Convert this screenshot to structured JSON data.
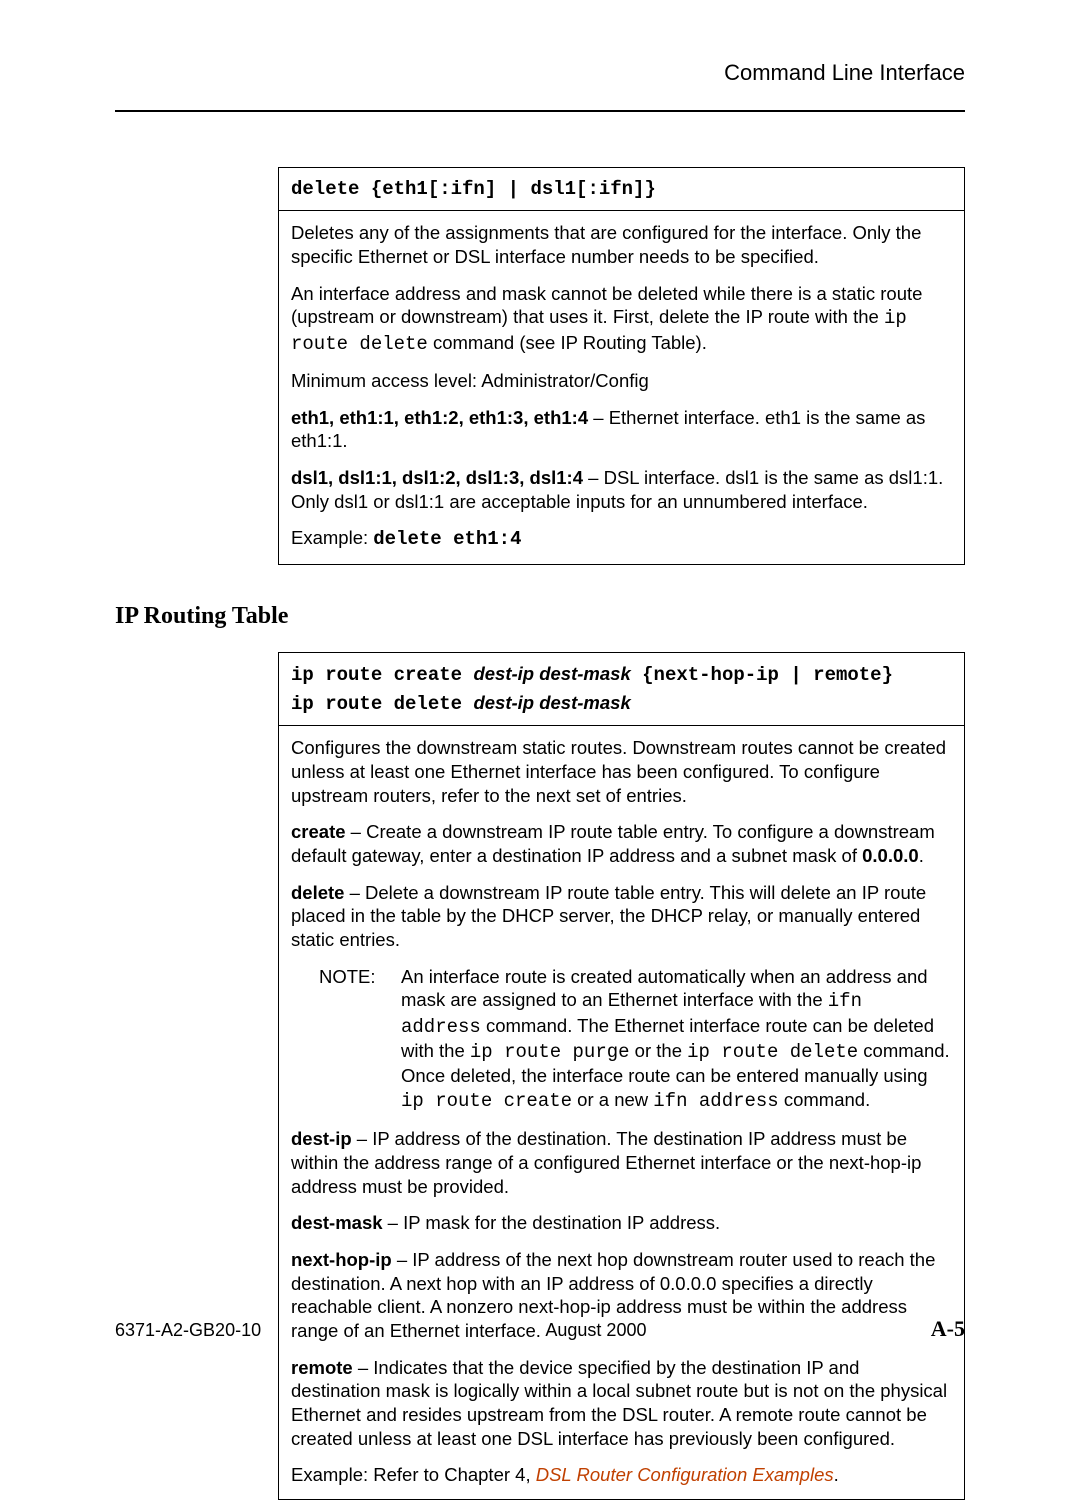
{
  "header": {
    "title": "Command Line Interface"
  },
  "box1": {
    "cmd": "delete {eth1[:ifn] | dsl1[:ifn]}",
    "p1": "Deletes any of the assignments that are configured for the interface. Only the specific Ethernet or DSL interface number needs to be specified.",
    "p2a": "An interface address and mask cannot be deleted while there is a static route (upstream or downstream) that uses it. First, delete the IP route with the ",
    "p2code": "ip route delete",
    "p2b": " command (see IP Routing Table).",
    "p3": "Minimum access level:  Administrator/Config",
    "p4b": "eth1, eth1:1, eth1:2, eth1:3, eth1:4",
    "p4t": " – Ethernet interface. eth1 is the same as eth1:1.",
    "p5b": "dsl1, dsl1:1, dsl1:2, dsl1:3, dsl1:4",
    "p5t1": " – DSL interface. dsl1 is the same as dsl1:1.",
    "p5t2": "Only dsl1 or dsl1:1 are acceptable inputs for an unnumbered interface.",
    "p6a": "Example:  ",
    "p6code": "delete eth1:4"
  },
  "section2": {
    "title": "IP Routing Table"
  },
  "box2": {
    "cmd1a": "ip route create ",
    "cmd1i": "dest-ip dest-mask",
    "cmd1b": " {next-hop-ip | remote}",
    "cmd2a": "ip route delete ",
    "cmd2i": "dest-ip dest-mask",
    "p1": "Configures the downstream static routes. Downstream routes cannot be created unless at least one Ethernet interface has been configured. To configure upstream routers, refer to the next set of entries.",
    "p2b": "create",
    "p2t1": " – Create a downstream IP route table entry. To configure a downstream default gateway, enter a destination IP address and a subnet mask of ",
    "p2t2": "0.0.0.0",
    "p2t3": ".",
    "p3b": "delete",
    "p3t": " – Delete a downstream IP route table entry. This will delete an IP route placed in the table by the DHCP server, the DHCP relay, or manually entered static entries.",
    "noteLabel": "NOTE:",
    "note_a": "An interface route is created automatically when an address and mask are assigned to an Ethernet interface with the ",
    "note_c1": "ifn address",
    "note_b": " command. The Ethernet interface route can be deleted with the ",
    "note_c2": "ip route purge",
    "note_c": " or the ",
    "note_c3": "ip route delete",
    "note_d": " command. Once deleted, the interface route can be entered manually using ",
    "note_c4": "ip route create",
    "note_e": " or a new ",
    "note_c5": "ifn address",
    "note_f": " command.",
    "p4b": "dest-ip",
    "p4t": " – IP address of the destination. The destination IP address must be within the address range of a configured Ethernet interface or the next-hop-ip address must be provided.",
    "p5b": "dest-mask",
    "p5t": " – IP mask for the destination IP address.",
    "p6b": "next-hop-ip",
    "p6t": " – IP address of the next hop downstream router used to reach the destination. A next hop with an IP address of 0.0.0.0 specifies a directly reachable client. A nonzero next-hop-ip address must be within the address range of an Ethernet interface.",
    "p7b": "remote",
    "p7t": " – Indicates that the device specified by the destination IP and destination mask is logically within a local subnet route but is not on the physical Ethernet and resides upstream from the DSL router. A remote route cannot be created unless at least one DSL interface has previously been configured.",
    "p8a": "Example:   Refer to Chapter 4, ",
    "p8link": "DSL Router Configuration Examples",
    "p8b": "."
  },
  "footer": {
    "doc": "6371-A2-GB20-10",
    "date": "August 2000",
    "page": "A-5"
  }
}
